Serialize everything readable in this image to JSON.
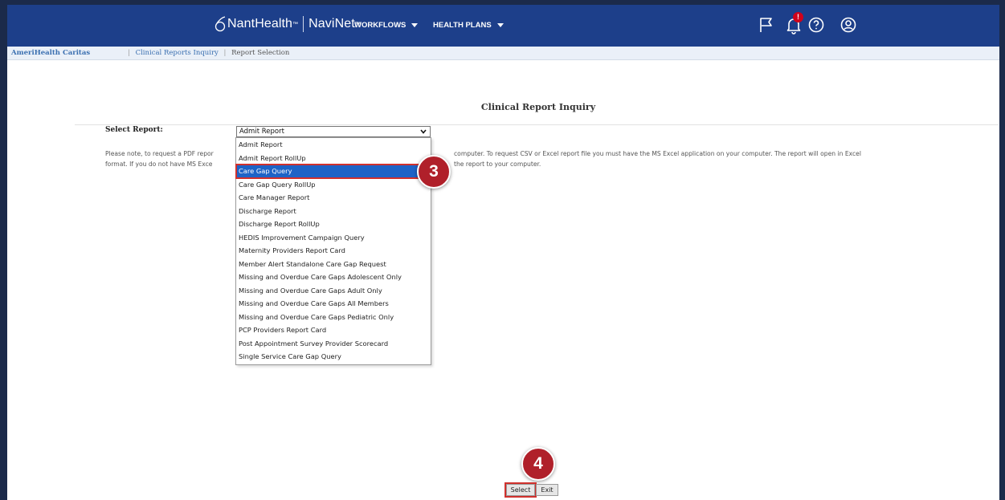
{
  "header": {
    "brand_nant": "NantHealth",
    "brand_tm": "™",
    "brand_navinet": "NaviNet",
    "menu": [
      {
        "label": "WORKFLOWS"
      },
      {
        "label": "HEALTH PLANS"
      }
    ],
    "notification_count": "!",
    "icons": [
      "flag-icon",
      "bell-icon",
      "help-icon",
      "user-icon"
    ],
    "bar_color": "#1d3f8a"
  },
  "breadcrumb": {
    "organization": "AmeriHealth Caritas",
    "items": [
      "Clinical Reports Inquiry",
      "Report Selection"
    ]
  },
  "main": {
    "title": "Clinical Report Inquiry",
    "select_label": "Select Report:",
    "selected_value": "Admit Report",
    "note_line1_start": "Please note, to request a PDF repor",
    "note_line1_end": "computer. To request CSV or Excel report file you must have the MS Excel application on your computer. The report will open in Excel",
    "note_line2_start": "format. If you do not have MS Exce",
    "note_line2_end": "the report to your computer.",
    "report_options": [
      "Admit Report",
      "Admit Report RollUp",
      "Care Gap Query",
      "Care Gap Query RollUp",
      "Care Manager Report",
      "Discharge Report",
      "Discharge Report RollUp",
      "HEDIS Improvement Campaign Query",
      "Maternity Providers Report Card",
      "Member Alert Standalone Care Gap Request",
      "Missing and Overdue Care Gaps Adolescent Only",
      "Missing and Overdue Care Gaps Adult Only",
      "Missing and Overdue Care Gaps All Members",
      "Missing and Overdue Care Gaps Pediatric Only",
      "PCP Providers Report Card",
      "Post Appointment Survey Provider Scorecard",
      "Single Service Care Gap Query"
    ],
    "highlighted_option": "Care Gap Query",
    "buttons": {
      "select": "Select",
      "exit": "Exit"
    }
  },
  "steps": {
    "step3": "3",
    "step4": "4"
  },
  "colors": {
    "highlight": "#1e63c6",
    "callout": "#b0202a",
    "outline": "#d0312d"
  }
}
